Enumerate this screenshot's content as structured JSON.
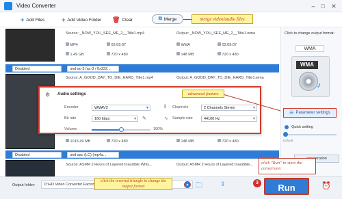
{
  "window": {
    "title": "Video Converter"
  },
  "toolbar": {
    "add_files": "Add Files",
    "add_video_folder": "Add Video Folder",
    "clear": "Clear",
    "merge": "Merge"
  },
  "files": [
    {
      "source": "Source: _NOW_YOU_SEE_ME_2__Title1.mp4",
      "output": "Output: _NOW_YOU_SEE_ME_2__Title1.wma",
      "src_format": "MP4",
      "src_duration": "02:09:07",
      "src_size": "1.49 GB",
      "src_res": "720 x 480",
      "out_format": "WMA",
      "out_duration": "02:09:07",
      "out_size": "148 MB",
      "out_res": "720 x 480",
      "subtitle": "Disabled",
      "audio": "und ac-3 (ac-3 / 0x332..."
    },
    {
      "source": "Source: A_GOOD_DAY_TO_DIE_HARD_Title1.mp4",
      "output": "Output: A_GOOD_DAY_TO_DIE_HARD_Title1.wma",
      "src_format": "MP4",
      "src_duration": "02:09:07",
      "src_size": "1015.49 MB",
      "src_res": "720 x 480",
      "out_format": "WMA",
      "out_duration": "02:09:07",
      "out_size": "148 MB",
      "out_res": "720 x 480",
      "subtitle": "Disabled",
      "audio": "und aac (LC) (mp4a..."
    },
    {
      "source": "Source: ASMR 2 Hours of Layered Inaudible Whis...",
      "output": "Output: ASMR 2 Hours of Layered Inaudible..."
    }
  ],
  "audio_dialog": {
    "title": "Audio settings",
    "encoder_label": "Encoder",
    "encoder_value": "WMAV2",
    "bitrate_label": "Bit rate",
    "bitrate_value": "160 kbps",
    "volume_label": "Volume",
    "volume_value": "100%",
    "volume_level": 0.5,
    "channels_label": "Channels",
    "channels_value": "2 Channels Stereo",
    "samplerate_label": "Sample rate",
    "samplerate_value": "44100 Hz"
  },
  "right_panel": {
    "click_label": "Click to change output format:",
    "format": "WMA",
    "param_button": "Parameter settings",
    "quick_setting": "Quick setting",
    "default_tick": "Default",
    "acceleration": "acceleration"
  },
  "bottom": {
    "output_folder_label": "Output folder:",
    "output_folder_value": "D:\\HD Video Converter Factory Pro",
    "run": "Run",
    "step_number": "3"
  },
  "callouts": {
    "merge": "merge video/audio files",
    "advanced": "advanced feature",
    "run": "click \"Run\" to start the conversion",
    "output": "click the inverted triangle to change the output format"
  },
  "colors": {
    "accent": "#2f7cd6",
    "callout_red": "#c0392b",
    "callout_yellow": "#fff59d"
  }
}
